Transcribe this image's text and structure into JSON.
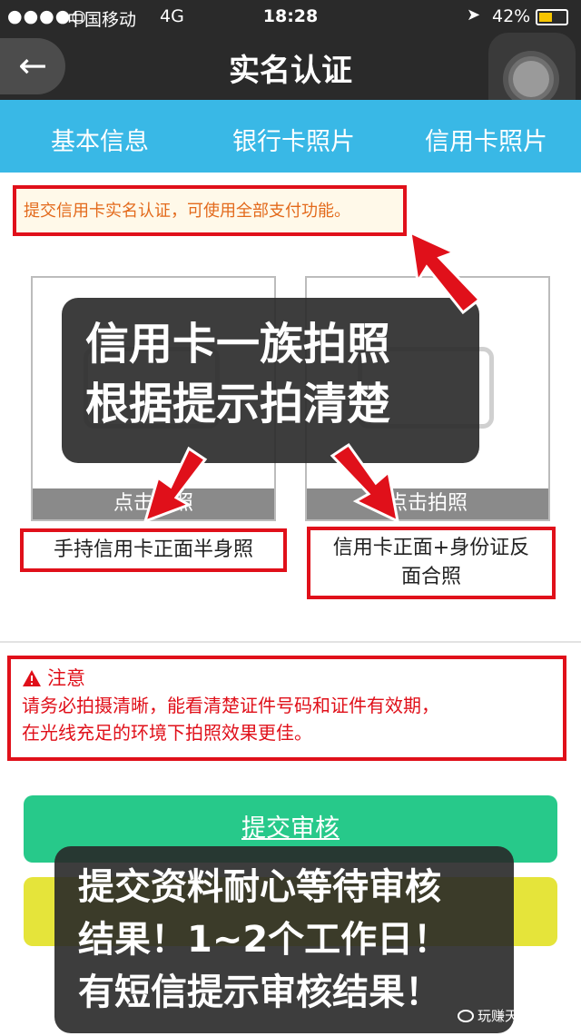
{
  "status_bar": {
    "signal": "●●●●○",
    "carrier": "中国移动",
    "network": "4G",
    "time": "18:28",
    "battery": "42%"
  },
  "nav": {
    "back_icon": "←",
    "title": "实名认证"
  },
  "tabs": [
    {
      "label": "基本信息"
    },
    {
      "label": "银行卡照片"
    },
    {
      "label": "信用卡照片"
    }
  ],
  "tip": "提交信用卡实名认证，可使用全部支付功能。",
  "photos": [
    {
      "caption": "点击拍照",
      "label": "手持信用卡正面半身照"
    },
    {
      "caption": "点击拍照",
      "label_line1": "信用卡正面+身份证反",
      "label_line2": "面合照"
    }
  ],
  "notice": {
    "title": "注意",
    "line1": "请务必拍摄清晰，能看清楚证件号码和证件有效期，",
    "line2": "在光线充足的环境下拍照效果更佳。"
  },
  "submit_label": "提交审核",
  "overlay_top": {
    "line1": "信用卡一族拍照",
    "line2": "根据提示拍清楚"
  },
  "overlay_bottom": {
    "line1": "提交资料耐心等待审核",
    "line2": "结果！1~2个工作日！",
    "line3": "有短信提示审核结果！"
  },
  "watermark": "玩赚天下集团",
  "colors": {
    "tab_bar": "#39b8e6",
    "highlight_red": "#e0101a",
    "submit_green": "#27c98a",
    "secondary_yellow": "#e5e43a"
  }
}
